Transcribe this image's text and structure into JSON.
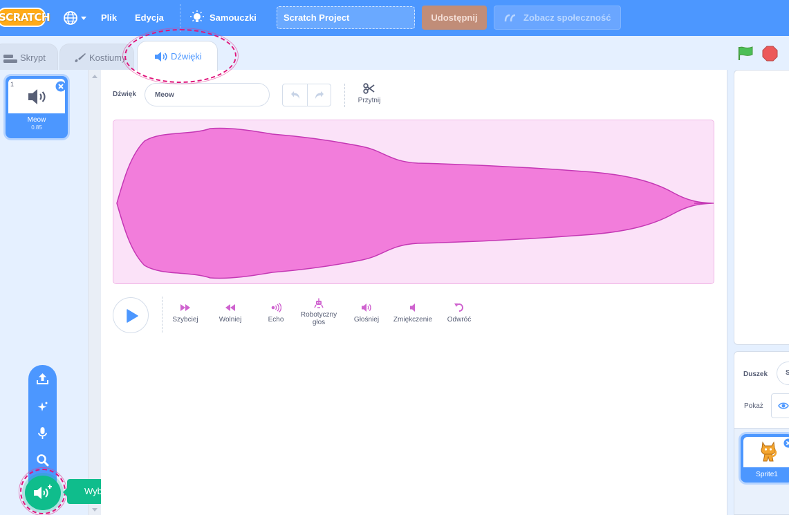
{
  "menubar": {
    "logo_text": "SCRATCH",
    "language_icon": "globe-icon",
    "file_label": "Plik",
    "edit_label": "Edycja",
    "tutorials_icon": "lightbulb-icon",
    "tutorials_label": "Samouczki",
    "project_title": "Scratch Project",
    "share_label": "Udostępnij",
    "see_community_label": "Zobacz społeczność"
  },
  "tabs": [
    {
      "label": "Skrypt",
      "icon": "code-icon"
    },
    {
      "label": "Kostiumy",
      "icon": "brush-icon"
    },
    {
      "label": "Dźwięki",
      "icon": "speaker-icon",
      "active": true
    }
  ],
  "controls": {
    "green_flag_icon": "green-flag-icon",
    "stop_icon": "stop-icon"
  },
  "sound_list": [
    {
      "index": "1",
      "name": "Meow",
      "duration": "0.85"
    }
  ],
  "add_sound_menu": {
    "items": [
      "upload-icon",
      "surprise-icon",
      "record-icon",
      "search-icon"
    ],
    "main_icon": "add-sound-icon",
    "tooltip": "Wybierz dźwięk"
  },
  "editor": {
    "sound_label": "Dźwięk",
    "sound_name_value": "Meow",
    "trim_label": "Przytnij",
    "effects": [
      {
        "label": "Szybciej",
        "icon": "faster-icon"
      },
      {
        "label": "Wolniej",
        "icon": "slower-icon"
      },
      {
        "label": "Echo",
        "icon": "echo-icon"
      },
      {
        "label": "Robotyczny głos",
        "icon": "robot-icon"
      },
      {
        "label": "Głośniej",
        "icon": "louder-icon"
      },
      {
        "label": "Zmiękczenie",
        "icon": "softer-icon"
      },
      {
        "label": "Odwróć",
        "icon": "reverse-icon"
      }
    ]
  },
  "sprite_info": {
    "sprite_label": "Duszek",
    "sprite_name_value": "S",
    "show_label": "Pokaż"
  },
  "sprites": [
    {
      "name": "Sprite1"
    }
  ],
  "colors": {
    "menubar": "#4c97ff",
    "accent": "#4c97ff",
    "sound_accent": "#cf63cf",
    "add_button": "#0fbd8c",
    "highlight": "#e0157b"
  }
}
